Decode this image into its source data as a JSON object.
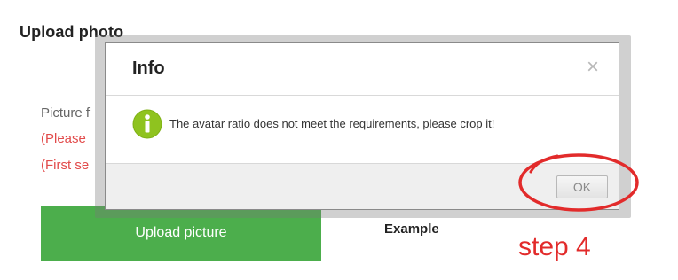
{
  "page": {
    "title": "Upload photo",
    "picture_line": "Picture f",
    "note_line_1": "(Please",
    "note_line_2": "(First se",
    "upload_button_label": "Upload picture",
    "example_label": "Example"
  },
  "dialog": {
    "title": "Info",
    "close_glyph": "×",
    "icon": "info-icon",
    "message": "The avatar ratio does not meet the requirements, please crop it!",
    "ok_label": "OK"
  },
  "annotation": {
    "step_label": "step 4",
    "color": "#e22b2b"
  },
  "colors": {
    "upload_button": "#4cae4c",
    "note_text": "#e24b4b",
    "info_icon": "#8fc31f"
  }
}
